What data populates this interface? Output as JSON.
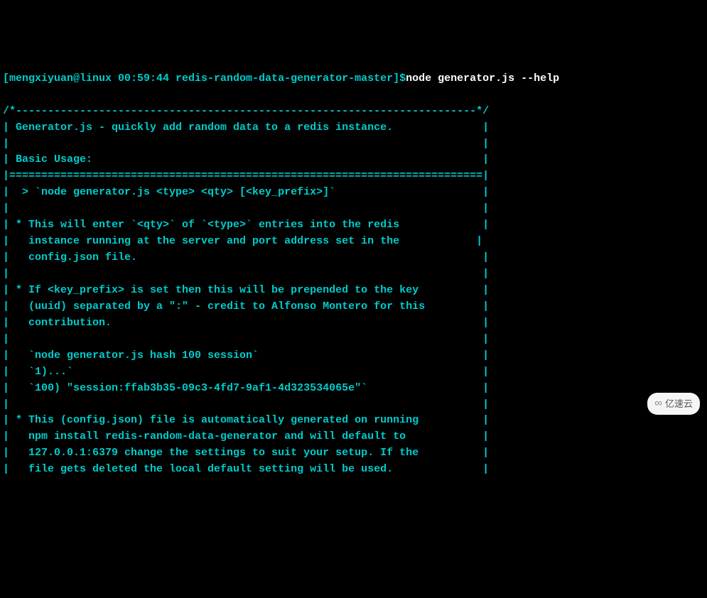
{
  "prompt": {
    "user_host": "[mengxiyuan@linux 00:59:44 redis-random-data-generator-master]$",
    "command": "node generator.js --help"
  },
  "help": {
    "top_border": "/*------------------------------------------------------------------------*/",
    "blank": "|                                                                          |",
    "title": "| Generator.js - quickly add random data to a redis instance.              |",
    "basic_usage": "| Basic Usage:                                                             |",
    "eq_divider": "|==========================================================================|",
    "usage_line": "|  > `node generator.js <type> <qty> [<key_prefix>]`                       |",
    "p1_l1": "| * This will enter `<qty>` of `<type>` entries into the redis             |",
    "p1_l2": "|   instance running at the server and port address set in the            |",
    "p1_l3": "|   config.json file.                                                      |",
    "p2_l1": "| * If <key_prefix> is set then this will be prepended to the key          |",
    "p2_l2": "|   (uuid) separated by a \":\" - credit to Alfonso Montero for this         |",
    "p2_l3": "|   contribution.                                                          |",
    "ex_l1": "|   `node generator.js hash 100 session`                                   |",
    "ex_l2": "|   `1)...`                                                                |",
    "ex_l3": "|   `100) \"session:ffab3b35-09c3-4fd7-9af1-4d323534065e\"`                  |",
    "p3_l1": "| * This (config.json) file is automatically generated on running          |",
    "p3_l2": "|   npm install redis-random-data-generator and will default to            |",
    "p3_l3": "|   127.0.0.1:6379 change the settings to suit your setup. If the          |",
    "p3_l4": "|   file gets deleted the local default setting will be used.              |"
  },
  "watermark": {
    "text": "亿速云"
  }
}
